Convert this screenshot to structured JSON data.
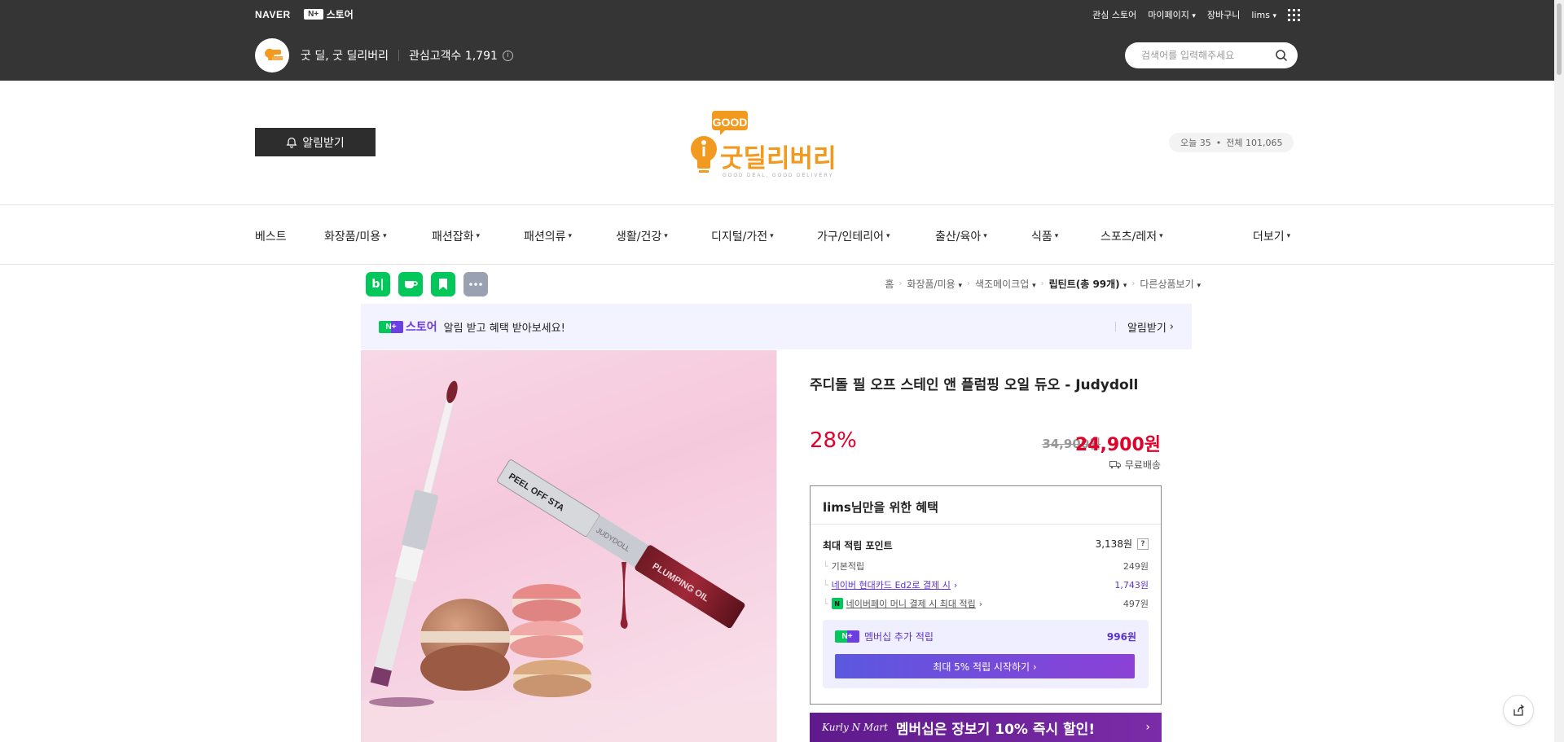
{
  "topbar": {
    "naver_logo": "NAVER",
    "nplus_mark": "N+",
    "store_label": "스토어",
    "links": [
      "관심 스토어",
      "마이페이지",
      "장바구니",
      "lims"
    ],
    "store_name": "굿 딜, 굿 딜리버리",
    "fans_label": "관심고객수 1,791",
    "search_placeholder": "검색어를 입력해주세요"
  },
  "header": {
    "alarm_label": "알림받기",
    "brand_good": "GOOD",
    "brand_name": "굿딜리버리",
    "brand_tagline": "GOOD DEAL, GOOD DELIVERY",
    "visit_today": "오늘 35",
    "visit_total": "전체 101,065"
  },
  "nav": {
    "items": [
      {
        "label": "베스트"
      },
      {
        "label": "화장품/미용"
      },
      {
        "label": "패션잡화"
      },
      {
        "label": "패션의류"
      },
      {
        "label": "생활/건강"
      },
      {
        "label": "디지털/가전"
      },
      {
        "label": "가구/인테리어"
      },
      {
        "label": "출산/육아"
      },
      {
        "label": "식품"
      },
      {
        "label": "스포츠/레저"
      },
      {
        "label": "더보기"
      }
    ]
  },
  "share": {
    "blog_label": "b|"
  },
  "breadcrumb": {
    "home": "홈",
    "cat1": "화장품/미용",
    "cat2": "색조메이크업",
    "cat3": "립틴트(총 99개)",
    "other": "다른상품보기"
  },
  "nplus_banner": {
    "logo_text": "스토어",
    "text": "알림 받고 혜택 받아보세요!",
    "action": "알림받기"
  },
  "product": {
    "title": "주디돌 필 오프 스테인 앤 플럼핑 오일 듀오 - Judydoll",
    "discount": "28%",
    "original_price": "34,900원",
    "sale_price": "24,900원",
    "shipping": "무료배송",
    "image_text_1": "PEEL OFF STA",
    "image_text_2": "PLUMPING OIL",
    "image_text_3": "JUDYDOLL"
  },
  "benefit": {
    "title": "lims님만을 위한 혜택",
    "max_points_label": "최대 적립 포인트",
    "max_points_value": "3,138원",
    "help": "?",
    "rows": [
      {
        "label": "기본적립",
        "value": "249원"
      },
      {
        "label": "네이버 현대카드 Ed2로 결제 시",
        "value": "1,743원"
      },
      {
        "label": "네이버페이 머니 결제 시 최대 적립",
        "value": "497원"
      }
    ],
    "member_label": "멤버십 추가 적립",
    "member_value": "996원",
    "member_cta": "최대 5% 적립 시작하기 ›"
  },
  "kurly": {
    "logo": "Kurly N Mart",
    "text": "멤버십은 장보기 10% 즉시 할인!"
  },
  "colors": {
    "topbar": "#353535",
    "price_red": "#e0002a",
    "naver_green": "#03c75a",
    "purple": "#5d32c8",
    "brand_orange": "#f29a1f"
  }
}
